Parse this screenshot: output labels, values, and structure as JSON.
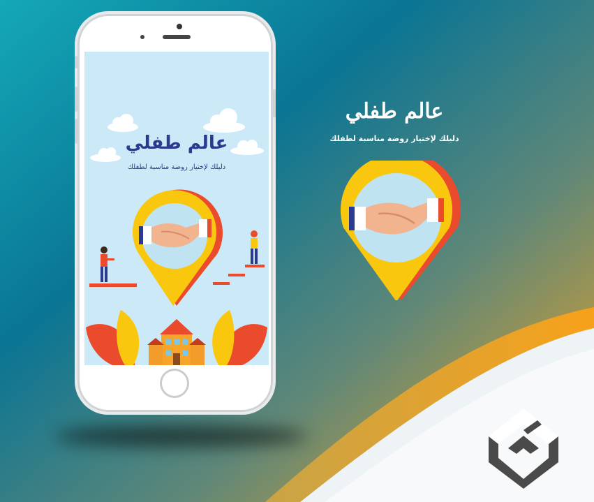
{
  "colors": {
    "bg_teal": "#0b7ea0",
    "bg_orange": "#f5a623",
    "title_blue": "#2b3a8f",
    "pin_yellow": "#f9c80e",
    "pin_red": "#e94b2c",
    "screen_sky": "#cce9f7"
  },
  "app_screen": {
    "title": "عالم طفلي",
    "subtitle": "دليلك لإختيار روضة مناسبة لطفلك",
    "illustration": "handshake-location-pin",
    "building": "kindergarten-building-icon"
  },
  "branding": {
    "title": "عالم طفلي",
    "subtitle": "دليلك لإختيار روضة مناسبة لطفلك",
    "logo": "studio-logo-icon"
  }
}
